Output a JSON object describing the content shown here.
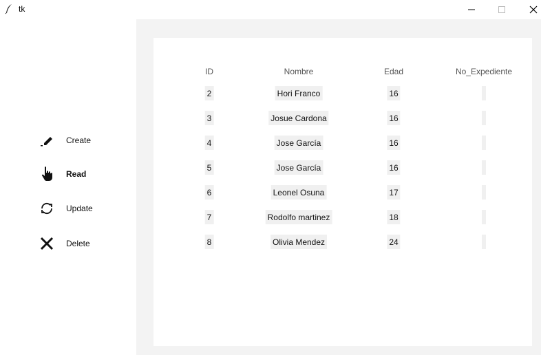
{
  "window": {
    "title": "tk"
  },
  "sidebar": {
    "items": [
      {
        "label": "Create",
        "icon": "pencil-icon",
        "active": false
      },
      {
        "label": "Read",
        "icon": "pointer-hand-icon",
        "active": true
      },
      {
        "label": "Update",
        "icon": "refresh-icon",
        "active": false
      },
      {
        "label": "Delete",
        "icon": "close-x-icon",
        "active": false
      }
    ]
  },
  "table": {
    "columns": [
      "ID",
      "Nombre",
      "Edad",
      "No_Expediente"
    ],
    "rows": [
      {
        "id": "2",
        "nombre": "Hori Franco",
        "edad": "16",
        "no_expediente": ""
      },
      {
        "id": "3",
        "nombre": "Josue Cardona",
        "edad": "16",
        "no_expediente": ""
      },
      {
        "id": "4",
        "nombre": "Jose García",
        "edad": "16",
        "no_expediente": ""
      },
      {
        "id": "5",
        "nombre": "Jose García",
        "edad": "16",
        "no_expediente": ""
      },
      {
        "id": "6",
        "nombre": "Leonel Osuna",
        "edad": "17",
        "no_expediente": ""
      },
      {
        "id": "7",
        "nombre": "Rodolfo martinez",
        "edad": "18",
        "no_expediente": ""
      },
      {
        "id": "8",
        "nombre": "Olivia Mendez",
        "edad": "24",
        "no_expediente": ""
      }
    ]
  }
}
